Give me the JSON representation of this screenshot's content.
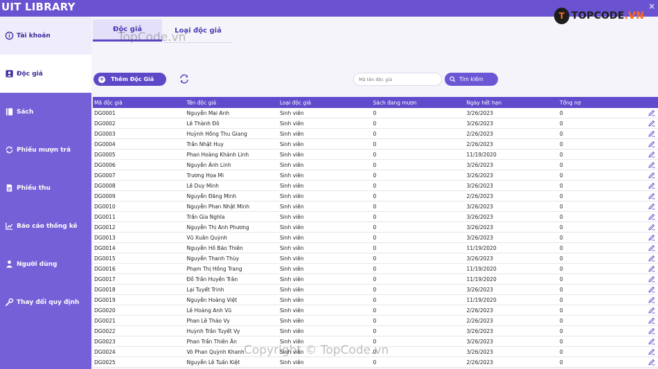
{
  "app": {
    "title": "UIT LIBRARY",
    "close_glyph": "×"
  },
  "sidebar": {
    "items": [
      {
        "label": "Tài khoản",
        "icon": "info-circle-icon"
      },
      {
        "label": "Độc giả",
        "icon": "user-square-icon"
      },
      {
        "label": "Sách",
        "icon": "book-icon"
      },
      {
        "label": "Phiếu mượn trả",
        "icon": "sync-icon"
      },
      {
        "label": "Phiếu thu",
        "icon": "document-icon"
      },
      {
        "label": "Báo cáo thống kê",
        "icon": "chart-icon"
      },
      {
        "label": "Người dùng",
        "icon": "person-icon"
      },
      {
        "label": "Thay đổi quy định",
        "icon": "wrench-icon"
      }
    ]
  },
  "tabs": [
    {
      "label": "Độc giả"
    },
    {
      "label": "Loại độc giả"
    }
  ],
  "toolbar": {
    "add_label": "Thêm Độc Giả",
    "search_placeholder": "Mã tên độc giả",
    "search_label": "Tìm kiếm"
  },
  "table": {
    "headers": [
      "Mã độc giả",
      "Tên độc giả",
      "Loại độc giả",
      "Sách đang mượn",
      "Ngày hết hạn",
      "Tổng nợ"
    ],
    "rows": [
      [
        "DG0001",
        "Nguyễn Mai Anh",
        "Sinh viên",
        "0",
        "3/26/2023",
        "0"
      ],
      [
        "DG0002",
        "Lê Thành Đô",
        "Sinh viên",
        "0",
        "3/26/2023",
        "0"
      ],
      [
        "DG0003",
        "Huỳnh Hồng Thu Giang",
        "Sinh viên",
        "0",
        "2/26/2023",
        "0"
      ],
      [
        "DG0004",
        "Trần Nhật Huy",
        "Sinh viên",
        "0",
        "2/26/2023",
        "0"
      ],
      [
        "DG0005",
        "Phan Hoàng Khánh Linh",
        "Sinh viên",
        "0",
        "11/19/2020",
        "0"
      ],
      [
        "DG0006",
        "Nguyễn Ánh Linh",
        "Sinh viên",
        "0",
        "3/26/2023",
        "0"
      ],
      [
        "DG0007",
        "Trương Họa Mi",
        "Sinh viên",
        "0",
        "3/26/2023",
        "0"
      ],
      [
        "DG0008",
        "Lê Duy Minh",
        "Sinh viên",
        "0",
        "3/26/2023",
        "0"
      ],
      [
        "DG0009",
        "Nguyễn Đăng Minh",
        "Sinh viên",
        "0",
        "2/26/2023",
        "0"
      ],
      [
        "DG0010",
        "Nguyễn Phan Nhật Minh",
        "Sinh viên",
        "0",
        "3/26/2023",
        "0"
      ],
      [
        "DG0011",
        "Trần Gia Nghĩa",
        "Sinh viên",
        "0",
        "3/26/2023",
        "0"
      ],
      [
        "DG0012",
        "Nguyễn Thị Anh Phương",
        "Sinh viên",
        "0",
        "3/26/2023",
        "0"
      ],
      [
        "DG0013",
        "Vũ Xuân Quỳnh",
        "Sinh viên",
        "0",
        "3/26/2023",
        "0"
      ],
      [
        "DG0014",
        "Nguyễn Hồ Bảo Thiên",
        "Sinh viên",
        "0",
        "11/19/2020",
        "0"
      ],
      [
        "DG0015",
        "Nguyễn Thanh Thùy",
        "Sinh viên",
        "0",
        "3/26/2023",
        "0"
      ],
      [
        "DG0016",
        "Phạm Thị Hồng Trang",
        "Sinh viên",
        "0",
        "11/19/2020",
        "0"
      ],
      [
        "DG0017",
        "Đỗ Trần Huyền Trân",
        "Sinh viên",
        "0",
        "11/19/2020",
        "0"
      ],
      [
        "DG0018",
        "Lại Tuyết Trinh",
        "Sinh viên",
        "0",
        "3/26/2023",
        "0"
      ],
      [
        "DG0019",
        "Nguyễn Hoàng Việt",
        "Sinh viên",
        "0",
        "11/19/2020",
        "0"
      ],
      [
        "DG0020",
        "Lê Hoàng Anh Vũ",
        "Sinh viên",
        "0",
        "2/26/2023",
        "0"
      ],
      [
        "DG0021",
        "Phan Lê Thảo Vy",
        "Sinh viên",
        "0",
        "2/26/2023",
        "0"
      ],
      [
        "DG0022",
        "Huỳnh Trần Tuyết Vy",
        "Sinh viên",
        "0",
        "3/26/2023",
        "0"
      ],
      [
        "DG0023",
        "Phan Trần Thiên Ân",
        "Sinh viên",
        "0",
        "3/26/2023",
        "0"
      ],
      [
        "DG0024",
        "Võ Phan Quỳnh Khanh",
        "Sinh viên",
        "0",
        "3/26/2023",
        "0"
      ],
      [
        "DG0025",
        "Nguyễn Lê Tuấn Kiệt",
        "Sinh viên",
        "0",
        "2/26/2023",
        "0"
      ]
    ]
  },
  "overlays": {
    "watermark_top": "TopCode.vn",
    "watermark_bottom": "Copyright © TopCode.vn",
    "logo_badge": "T",
    "logo_text_main": "TOPCODE",
    "logo_text_accent": ".VN"
  },
  "colors": {
    "titlebar": "#6a52d1",
    "sidebar": "#7560d8",
    "accent": "#5f4bcb",
    "logo_orange": "#ff6b1a"
  }
}
